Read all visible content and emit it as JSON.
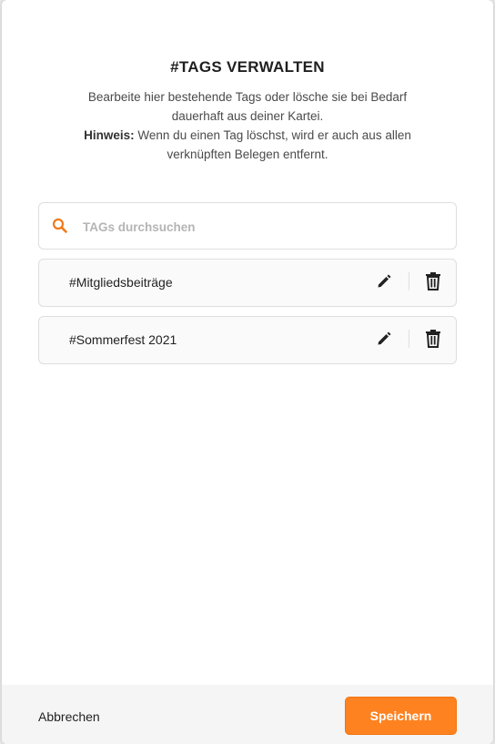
{
  "dialog": {
    "title": "#TAGS VERWALTEN",
    "description_line1": "Bearbeite hier bestehende Tags oder lösche sie bei Bedarf",
    "description_line2": "dauerhaft aus deiner Kartei.",
    "hint_label": "Hinweis:",
    "hint_text_line1": " Wenn du einen Tag löschst, wird er auch aus allen",
    "hint_text_line2": "verknüpften Belegen entfernt."
  },
  "search": {
    "placeholder": "TAGs durchsuchen",
    "value": "",
    "icon": "search-icon"
  },
  "tags": [
    {
      "label": "#Mitgliedsbeiträge"
    },
    {
      "label": "#Sommerfest 2021"
    }
  ],
  "footer": {
    "cancel_label": "Abbrechen",
    "save_label": "Speichern"
  },
  "colors": {
    "accent": "#ff8220",
    "search_icon": "#f07a1a"
  }
}
